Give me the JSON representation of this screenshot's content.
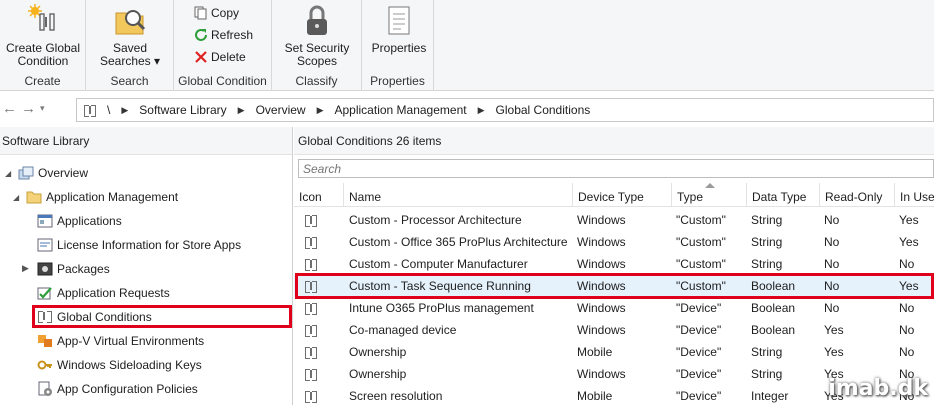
{
  "ribbon": {
    "groups": [
      {
        "label": "Create",
        "buttons": [
          {
            "label_line1": "Create Global",
            "label_line2": "Condition"
          }
        ]
      },
      {
        "label": "Search",
        "buttons": [
          {
            "label_line1": "Saved",
            "label_line2": "Searches ▾"
          }
        ]
      },
      {
        "label": "Global Condition",
        "small_buttons": [
          "Copy",
          "Refresh",
          "Delete"
        ]
      },
      {
        "label": "Classify",
        "buttons": [
          {
            "label_line1": "Set Security",
            "label_line2": "Scopes"
          }
        ]
      },
      {
        "label": "Properties",
        "buttons": [
          {
            "label_line1": "Properties",
            "label_line2": ""
          }
        ]
      }
    ]
  },
  "breadcrumb": {
    "root": "\\",
    "items": [
      "Software Library",
      "Overview",
      "Application Management",
      "Global Conditions"
    ]
  },
  "left_pane": {
    "title": "Software Library",
    "tree": [
      {
        "label": "Overview",
        "icon": "overview-icon"
      },
      {
        "label": "Application Management",
        "icon": "folder-icon"
      },
      {
        "label": "Applications",
        "icon": "applications-icon"
      },
      {
        "label": "License Information for Store Apps",
        "icon": "license-icon"
      },
      {
        "label": "Packages",
        "icon": "packages-icon"
      },
      {
        "label": "Application Requests",
        "icon": "requests-icon"
      },
      {
        "label": "Global Conditions",
        "icon": "global-condition-icon"
      },
      {
        "label": "App-V Virtual Environments",
        "icon": "appv-icon"
      },
      {
        "label": "Windows Sideloading Keys",
        "icon": "key-icon"
      },
      {
        "label": "App Configuration Policies",
        "icon": "config-policy-icon"
      }
    ]
  },
  "right_pane": {
    "title": "Global Conditions",
    "count": "26 items",
    "search_placeholder": "Search",
    "columns": [
      "Icon",
      "Name",
      "Device Type",
      "Type",
      "Data Type",
      "Read-Only",
      "In Use"
    ],
    "rows": [
      [
        "Custom - Processor Architecture",
        "Windows",
        "\"Custom\"",
        "String",
        "No",
        "Yes"
      ],
      [
        "Custom - Office 365 ProPlus Architecture",
        "Windows",
        "\"Custom\"",
        "String",
        "No",
        "Yes"
      ],
      [
        "Custom - Computer Manufacturer",
        "Windows",
        "\"Custom\"",
        "String",
        "No",
        "No"
      ],
      [
        "Custom - Task Sequence Running",
        "Windows",
        "\"Custom\"",
        "Boolean",
        "No",
        "Yes"
      ],
      [
        "Intune O365 ProPlus management",
        "Windows",
        "\"Device\"",
        "Boolean",
        "No",
        "No"
      ],
      [
        "Co-managed device",
        "Windows",
        "\"Device\"",
        "Boolean",
        "Yes",
        "No"
      ],
      [
        "Ownership",
        "Mobile",
        "\"Device\"",
        "String",
        "Yes",
        "No"
      ],
      [
        "Ownership",
        "Windows",
        "\"Device\"",
        "String",
        "Yes",
        "No"
      ],
      [
        "Screen resolution",
        "Mobile",
        "\"Device\"",
        "Integer",
        "Yes",
        "No"
      ]
    ]
  },
  "watermark": "imab.dk",
  "colors": {
    "highlight": "#e0001b",
    "selected_row": "#e5f1fb",
    "ribbon_bg": "#f5f6f7"
  }
}
